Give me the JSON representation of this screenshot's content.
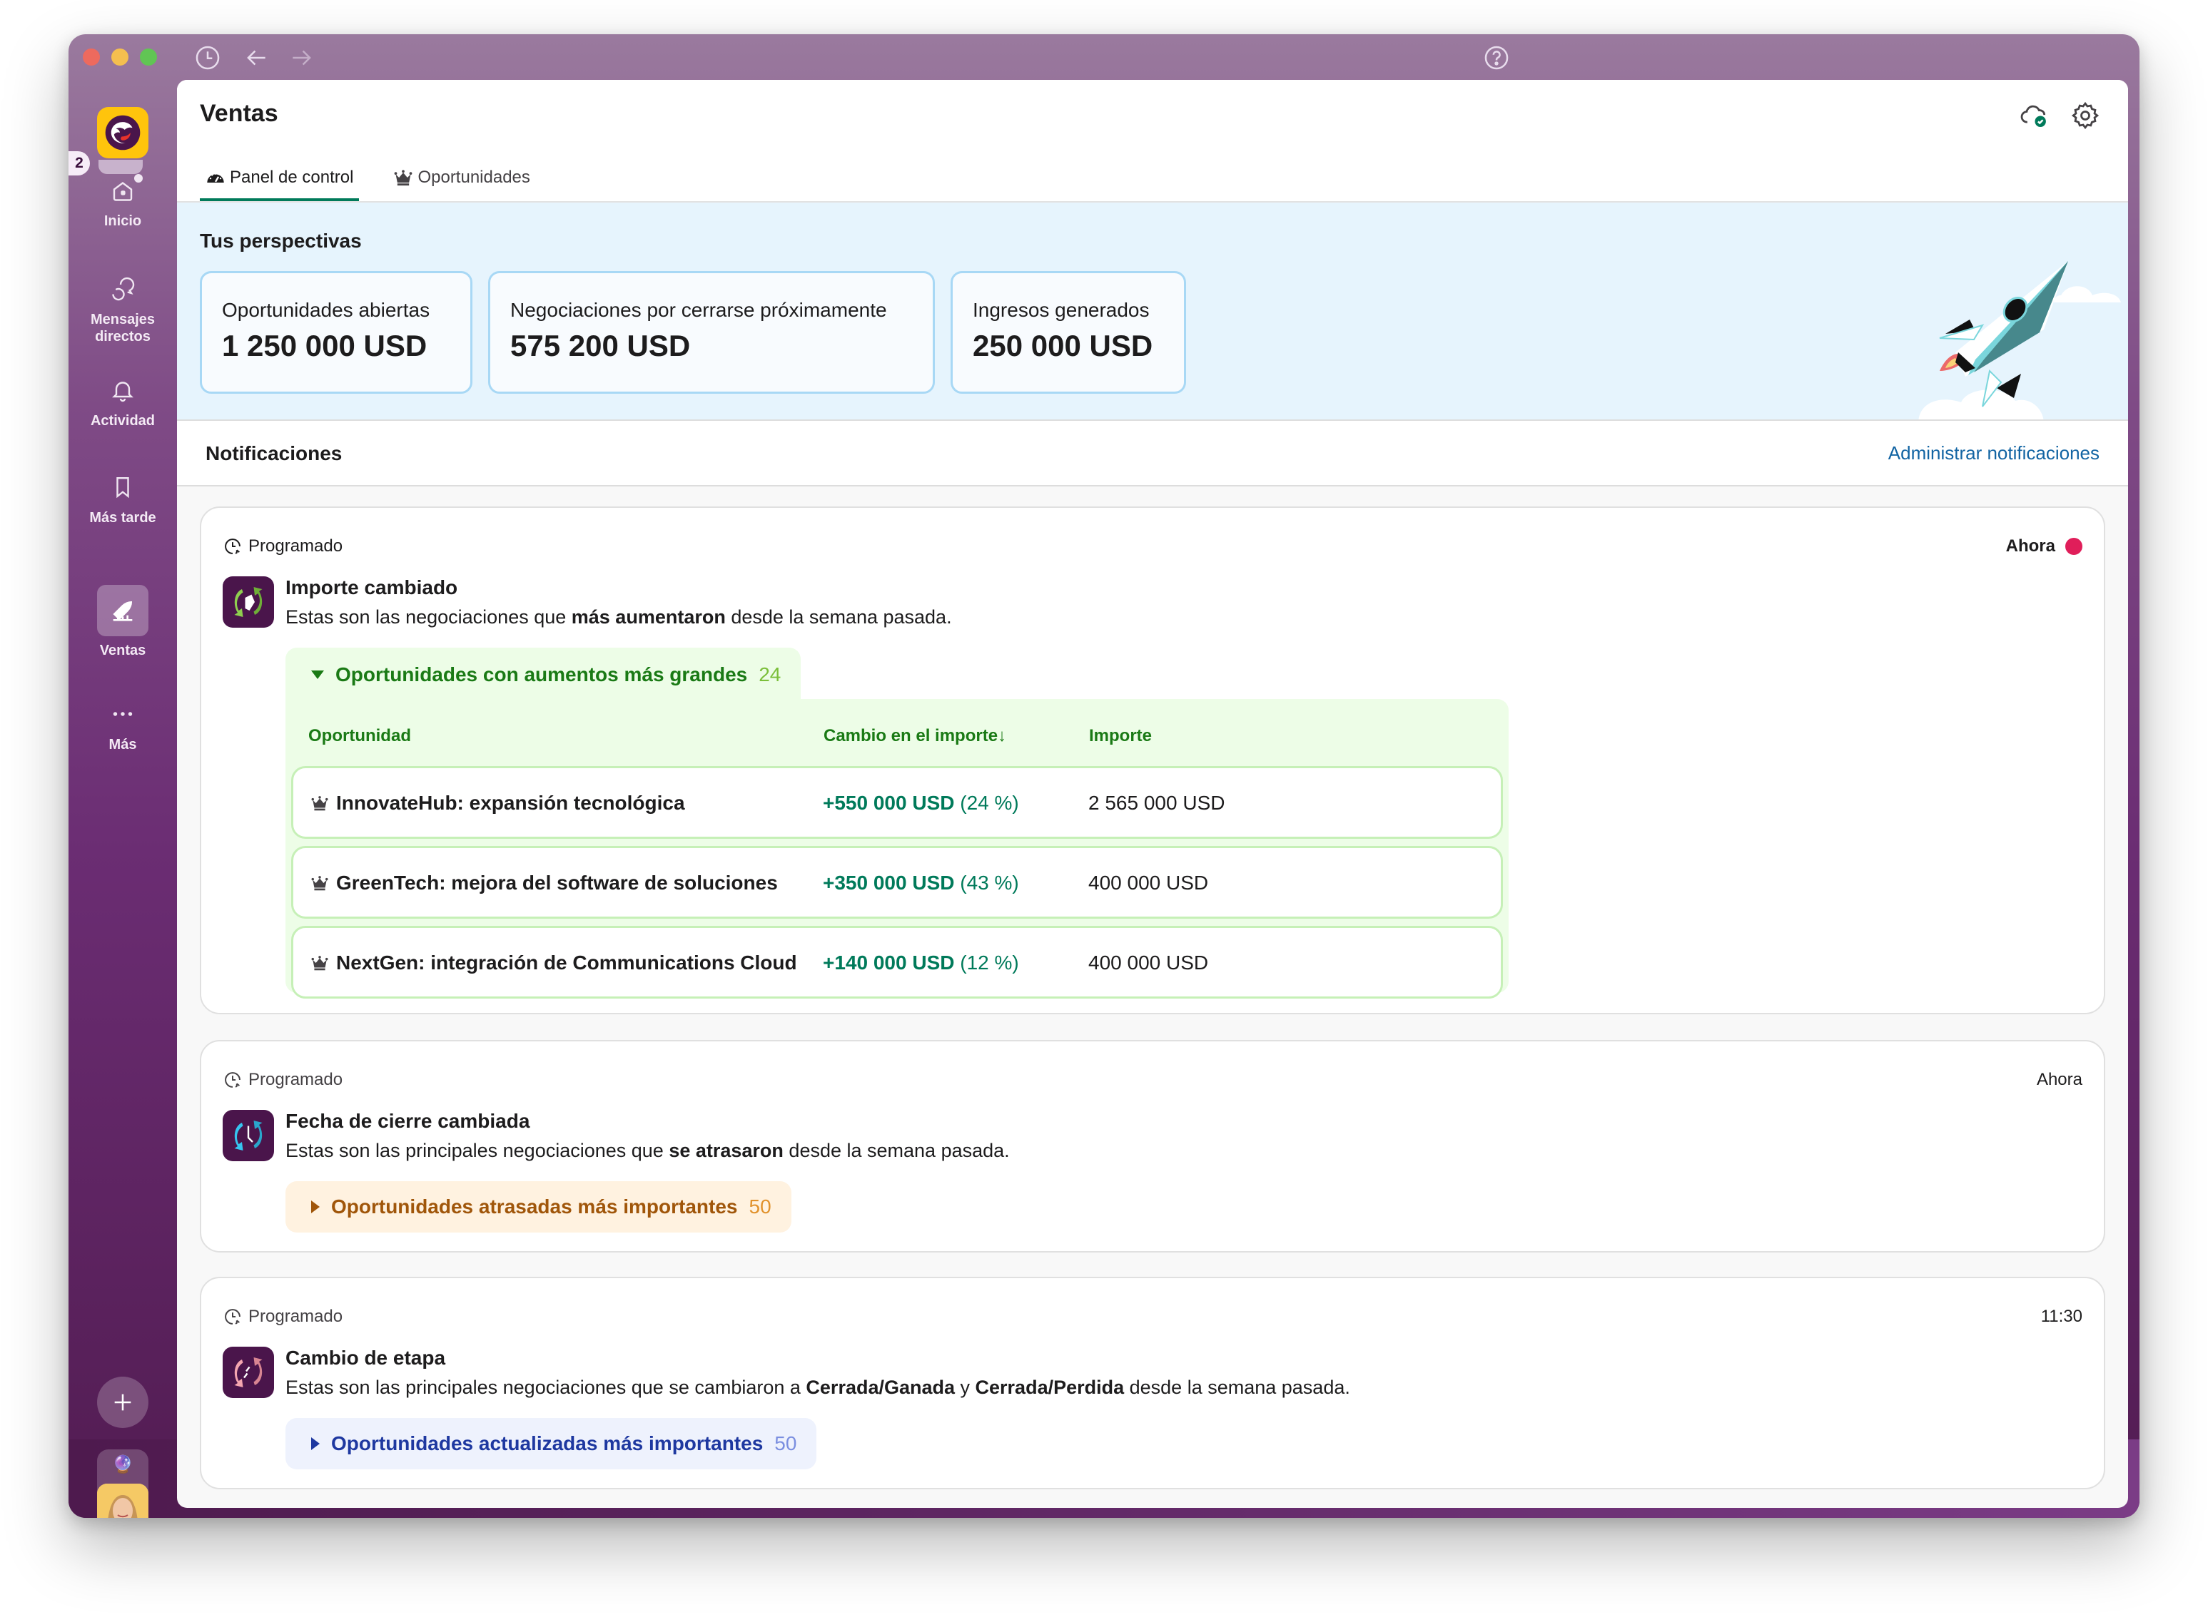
{
  "titlebar": {
    "icons": [
      "history-icon",
      "back-arrow-icon",
      "forward-arrow-icon",
      "help-icon"
    ]
  },
  "sidebar": {
    "workspace_badge": "2",
    "items": [
      {
        "label": "Inicio",
        "icon": "home-icon"
      },
      {
        "label": "Mensajes directos",
        "icon": "direct-messages-icon"
      },
      {
        "label": "Actividad",
        "icon": "bell-icon"
      },
      {
        "label": "Más tarde",
        "icon": "bookmark-icon"
      },
      {
        "label": "Ventas",
        "icon": "rocket-chart-icon",
        "active": true
      },
      {
        "label": "Más",
        "icon": "more-icon"
      }
    ],
    "add_icon": "plus-icon",
    "status_emoji": "🔮"
  },
  "header": {
    "title": "Ventas",
    "tabs": [
      {
        "label": "Panel de control",
        "icon": "dashboard-gauge-icon",
        "active": true
      },
      {
        "label": "Oportunidades",
        "icon": "crown-icon",
        "active": false
      }
    ]
  },
  "insights": {
    "title": "Tus perspectivas",
    "kpis": [
      {
        "label": "Oportunidades abiertas",
        "value": "1 250 000 USD"
      },
      {
        "label": "Negociaciones por cerrarse próximamente",
        "value": "575 200 USD"
      },
      {
        "label": "Ingresos generados",
        "value": "250 000 USD"
      }
    ]
  },
  "notifications": {
    "title": "Notificaciones",
    "manage_link": "Administrar notificaciones",
    "cards": [
      {
        "scheduled": "Programado",
        "time": "Ahora",
        "unread": true,
        "heading": "Importe cambiado",
        "desc_pre": "Estas son las negociaciones que ",
        "desc_bold": "más aumentaron",
        "desc_post": " desde la semana pasada.",
        "group": {
          "label": "Oportunidades con aumentos más grandes",
          "count": "24",
          "expanded": true
        },
        "table": {
          "headers": [
            "Oportunidad",
            "Cambio en el importe↓",
            "Importe"
          ],
          "rows": [
            {
              "name": "InnovateHub: expansión tecnológica",
              "change": "+550 000 USD",
              "pct": "(24 %)",
              "amount": "2 565 000 USD"
            },
            {
              "name": "GreenTech: mejora del software de soluciones",
              "change": "+350 000 USD",
              "pct": "(43 %)",
              "amount": "400 000 USD"
            },
            {
              "name": "NextGen: integración de Communications Cloud",
              "change": "+140 000 USD",
              "pct": "(12 %)",
              "amount": "400 000 USD"
            }
          ]
        }
      },
      {
        "scheduled": "Programado",
        "time": "Ahora",
        "unread": false,
        "heading": "Fecha de cierre cambiada",
        "desc_pre": "Estas son las principales negociaciones que ",
        "desc_bold": "se atrasaron",
        "desc_post": " desde la semana pasada.",
        "group": {
          "label": "Oportunidades atrasadas más importantes",
          "count": "50",
          "expanded": false
        }
      },
      {
        "scheduled": "Programado",
        "time": "11:30",
        "unread": false,
        "heading": "Cambio de etapa",
        "desc_pre": "Estas son las principales negociaciones que se cambiaron a ",
        "desc_bold": "Cerrada/Ganada",
        "desc_mid": " y ",
        "desc_bold2": "Cerrada/Perdida",
        "desc_post": " desde la semana pasada.",
        "group": {
          "label": "Oportunidades actualizadas más importantes",
          "count": "50",
          "expanded": false
        }
      }
    ]
  },
  "colors": {
    "accent_green": "#007a5a",
    "link_blue": "#1264a3",
    "unread_red": "#e01e5a",
    "sidebar_purple": "#6b2d73"
  }
}
